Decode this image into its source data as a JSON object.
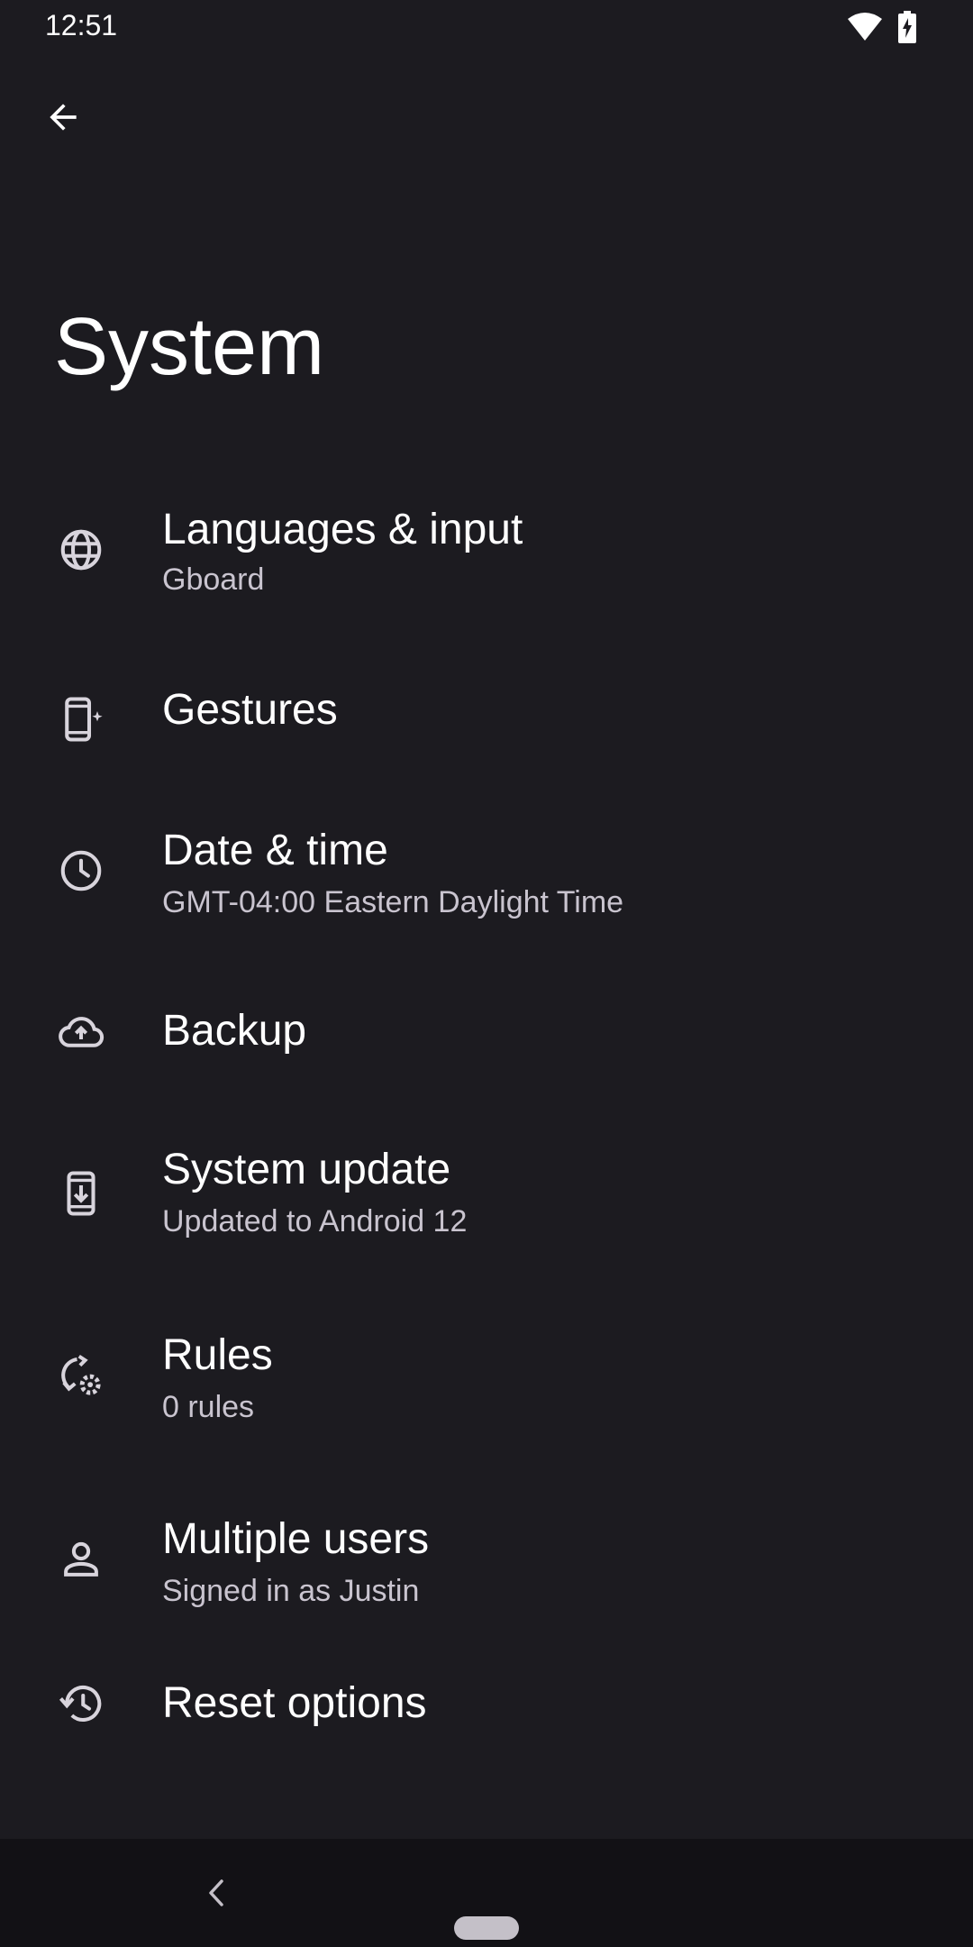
{
  "status_bar": {
    "time": "12:51",
    "icons": [
      "wifi-icon",
      "battery-charging-icon"
    ]
  },
  "header": {
    "back_icon": "arrow-back-icon",
    "title": "System"
  },
  "items": [
    {
      "title": "Languages & input",
      "subtitle": "Gboard",
      "icon": "globe-icon"
    },
    {
      "title": "Gestures",
      "subtitle": "",
      "icon": "gestures-phone-icon"
    },
    {
      "title": "Date & time",
      "subtitle": "GMT-04:00 Eastern Daylight Time",
      "icon": "clock-icon"
    },
    {
      "title": "Backup",
      "subtitle": "",
      "icon": "cloud-upload-icon"
    },
    {
      "title": "System update",
      "subtitle": "Updated to Android 12",
      "icon": "system-update-icon"
    },
    {
      "title": "Rules",
      "subtitle": "0 rules",
      "icon": "rules-icon"
    },
    {
      "title": "Multiple users",
      "subtitle": "Signed in as Justin",
      "icon": "person-icon"
    },
    {
      "title": "Reset options",
      "subtitle": "",
      "icon": "history-icon"
    }
  ],
  "nav_bar": {
    "back_icon": "nav-back-icon",
    "home_icon": "nav-home-pill-icon"
  },
  "colors": {
    "background": "#1c1b20",
    "text_primary": "#ffffff",
    "text_secondary": "#c9c4cf",
    "icon": "#d8d4dc",
    "nav_bar": "#121115"
  }
}
